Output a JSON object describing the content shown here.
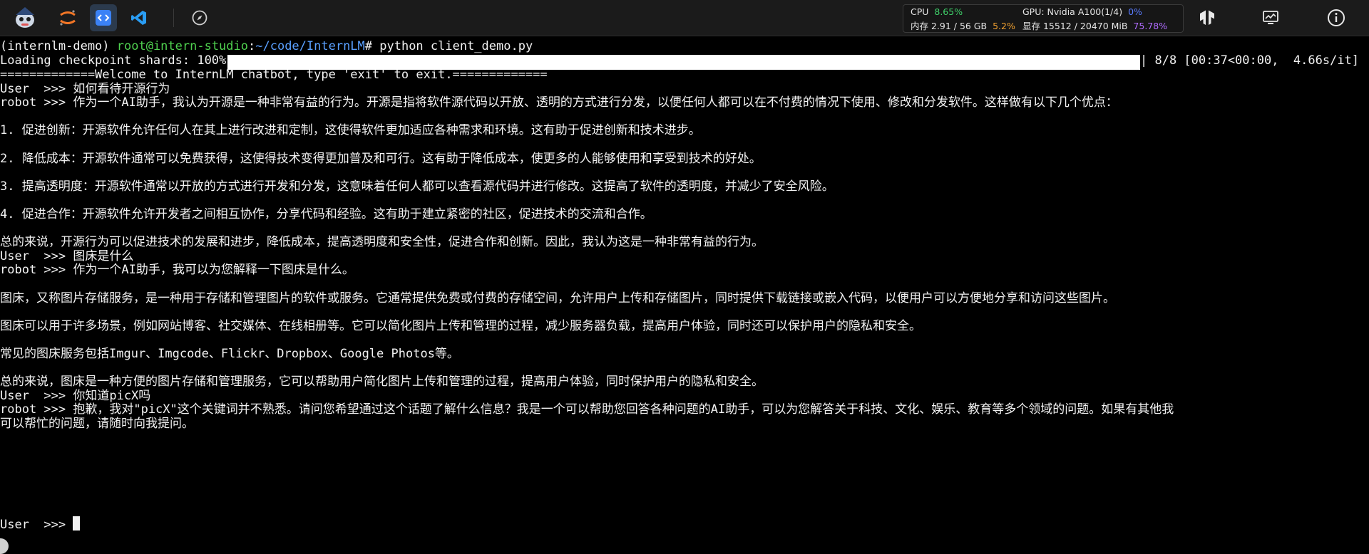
{
  "toolbar": {
    "icons": [
      "mascot-icon",
      "jupyter-icon",
      "code-icon",
      "vscode-icon",
      "compass-icon"
    ],
    "right_icons": [
      "tensorflow-icon",
      "monitor-icon",
      "info-icon"
    ]
  },
  "stats": {
    "cpu_label": "CPU",
    "cpu_value": "8.65%",
    "mem_label": "内存 2.91 / 56 GB",
    "mem_value": "5.2%",
    "gpu_label": "GPU: Nvidia A100(1/4)",
    "gpu_value": "0%",
    "vram_label": "显存 15512 / 20470 MiB",
    "vram_value": "75.78%"
  },
  "terminal": {
    "prompt_env": "(internlm-demo) ",
    "prompt_user": "root@intern-studio",
    "prompt_colon": ":",
    "prompt_path": "~/code/InternLM",
    "prompt_cmd": "# python client_demo.py",
    "loading_label": "Loading checkpoint shards: 100%|",
    "loading_stats": "| 8/8 [00:37<00:00,  4.66s/it]",
    "loading_percent": 100,
    "lines": [
      "=============Welcome to InternLM chatbot, type 'exit' to exit.=============",
      "User  >>> 如何看待开源行为",
      "robot >>> 作为一个AI助手，我认为开源是一种非常有益的行为。开源是指将软件源代码以开放、透明的方式进行分发，以便任何人都可以在不付费的情况下使用、修改和分发软件。这样做有以下几个优点：",
      "",
      "1. 促进创新：开源软件允许任何人在其上进行改进和定制，这使得软件更加适应各种需求和环境。这有助于促进创新和技术进步。",
      "",
      "2. 降低成本：开源软件通常可以免费获得，这使得技术变得更加普及和可行。这有助于降低成本，使更多的人能够使用和享受到技术的好处。",
      "",
      "3. 提高透明度：开源软件通常以开放的方式进行开发和分发，这意味着任何人都可以查看源代码并进行修改。这提高了软件的透明度，并减少了安全风险。",
      "",
      "4. 促进合作：开源软件允许开发者之间相互协作，分享代码和经验。这有助于建立紧密的社区，促进技术的交流和合作。",
      "",
      "总的来说，开源行为可以促进技术的发展和进步，降低成本，提高透明度和安全性，促进合作和创新。因此，我认为这是一种非常有益的行为。",
      "User  >>> 图床是什么",
      "robot >>> 作为一个AI助手，我可以为您解释一下图床是什么。",
      "",
      "图床，又称图片存储服务，是一种用于存储和管理图片的软件或服务。它通常提供免费或付费的存储空间，允许用户上传和存储图片，同时提供下载链接或嵌入代码，以便用户可以方便地分享和访问这些图片。",
      "",
      "图床可以用于许多场景，例如网站博客、社交媒体、在线相册等。它可以简化图片上传和管理的过程，减少服务器负载，提高用户体验，同时还可以保护用户的隐私和安全。",
      "",
      "常见的图床服务包括Imgur、Imgcode、Flickr、Dropbox、Google Photos等。",
      "",
      "总的来说，图床是一种方便的图片存储和管理服务，它可以帮助用户简化图片上传和管理的过程，提高用户体验，同时保护用户的隐私和安全。",
      "User  >>> 你知道picX吗",
      "robot >>> 抱歉，我对\"picX\"这个关键词并不熟悉。请问您希望通过这个话题了解什么信息？我是一个可以帮助您回答各种问题的AI助手，可以为您解答关于科技、文化、娱乐、教育等多个领域的问题。如果有其他我",
      "可以帮忙的问题，请随时向我提问。"
    ],
    "input_prompt": "User  >>> "
  }
}
